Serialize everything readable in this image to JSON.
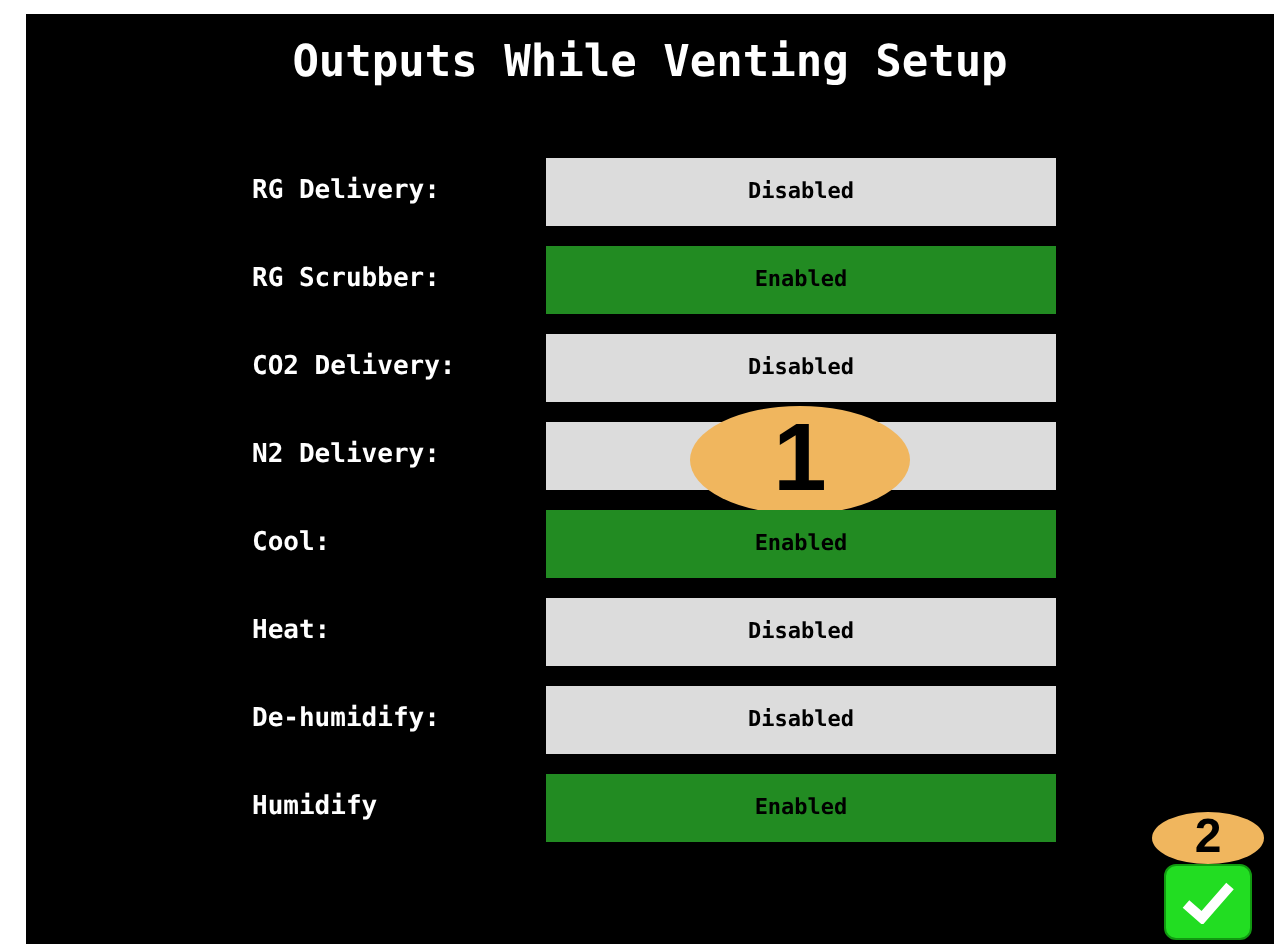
{
  "title": "Outputs While Venting Setup",
  "rows": [
    {
      "label": "RG Delivery:",
      "enabled": false,
      "value": "Disabled"
    },
    {
      "label": "RG Scrubber:",
      "enabled": true,
      "value": "Enabled"
    },
    {
      "label": "CO2 Delivery:",
      "enabled": false,
      "value": "Disabled"
    },
    {
      "label": "N2 Delivery:",
      "enabled": false,
      "callout": "1"
    },
    {
      "label": "Cool:",
      "enabled": true,
      "value": "Enabled"
    },
    {
      "label": "Heat:",
      "enabled": false,
      "value": "Disabled"
    },
    {
      "label": "De-humidify:",
      "enabled": false,
      "value": "Disabled"
    },
    {
      "label": "Humidify",
      "enabled": true,
      "value": "Enabled"
    }
  ],
  "confirm": {
    "callout": "2"
  }
}
